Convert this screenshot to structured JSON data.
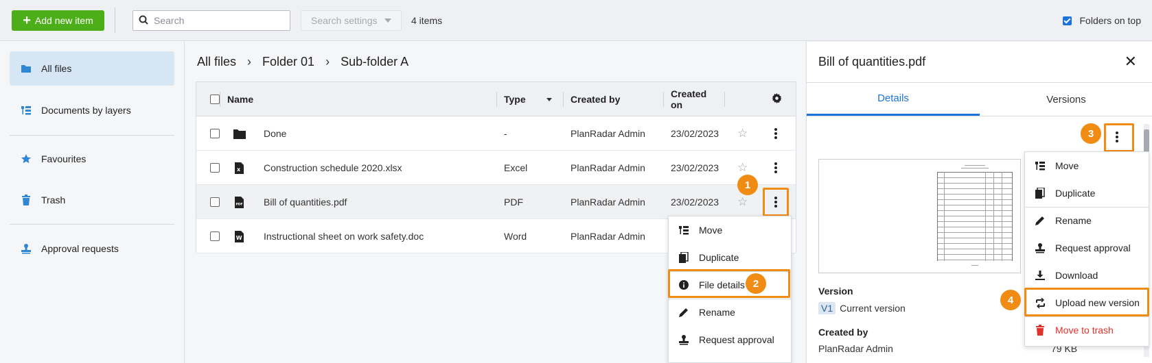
{
  "topbar": {
    "add_label": "Add new item",
    "search_placeholder": "Search",
    "search_settings_label": "Search settings",
    "items_count": "4 items",
    "folders_on_top_label": "Folders on top"
  },
  "sidebar": {
    "items": [
      {
        "label": "All files",
        "icon": "folder-icon"
      },
      {
        "label": "Documents by layers",
        "icon": "layers-icon"
      },
      {
        "label": "Favourites",
        "icon": "star-icon"
      },
      {
        "label": "Trash",
        "icon": "trash-icon"
      },
      {
        "label": "Approval requests",
        "icon": "stamp-icon"
      }
    ]
  },
  "breadcrumb": [
    "All files",
    "Folder 01",
    "Sub-folder A"
  ],
  "table": {
    "headers": {
      "name": "Name",
      "type": "Type",
      "created_by": "Created by",
      "created_on": "Created on"
    },
    "rows": [
      {
        "name": "Done",
        "type": "-",
        "created_by": "PlanRadar Admin",
        "created_on": "23/02/2023",
        "icon": "folder-icon"
      },
      {
        "name": "Construction schedule 2020.xlsx",
        "type": "Excel",
        "created_by": "PlanRadar Admin",
        "created_on": "23/02/2023",
        "icon": "excel-file-icon"
      },
      {
        "name": "Bill of quantities.pdf",
        "type": "PDF",
        "created_by": "PlanRadar Admin",
        "created_on": "23/02/2023",
        "icon": "pdf-file-icon"
      },
      {
        "name": "Instructional sheet on work safety.doc",
        "type": "Word",
        "created_by": "PlanRadar Admin",
        "created_on": "",
        "icon": "word-file-icon"
      }
    ]
  },
  "row_menu": {
    "items": [
      "Move",
      "Duplicate",
      "File details",
      "Rename",
      "Request approval"
    ]
  },
  "panel": {
    "title": "Bill of quantities.pdf",
    "tabs": [
      "Details",
      "Versions"
    ],
    "version_label": "Version",
    "version_badge": "V1",
    "version_value": "Current version",
    "created_by_label": "Created by",
    "created_by_value": "PlanRadar Admin",
    "size": "79 KB"
  },
  "panel_menu": {
    "items": [
      "Move",
      "Duplicate",
      "Rename",
      "Request approval",
      "Download",
      "Upload new version",
      "Move to trash"
    ]
  },
  "steps": [
    "1",
    "2",
    "3",
    "4"
  ],
  "colors": {
    "accent": "#1a73d9",
    "highlight": "#f08c14",
    "add_button": "#4cae19",
    "danger": "#e0312b"
  }
}
